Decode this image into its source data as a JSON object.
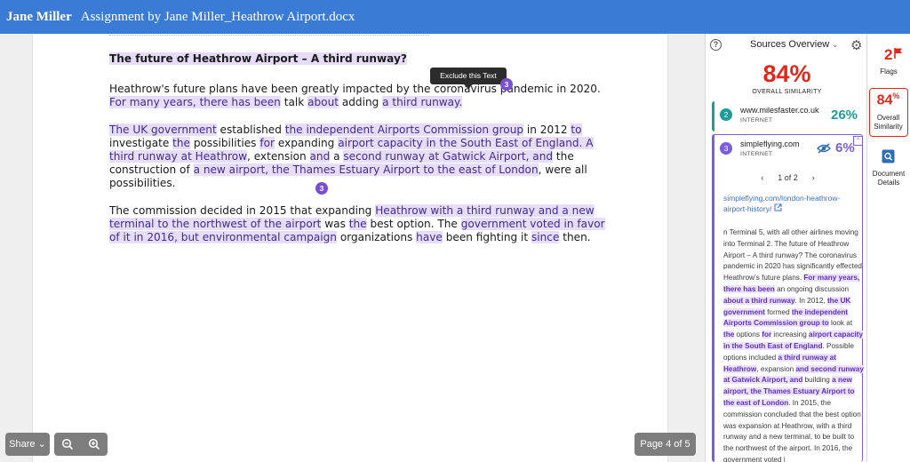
{
  "header": {
    "user": "Jane Miller",
    "doc_title": "Assignment by Jane Miller_Heathrow Airport.docx"
  },
  "document": {
    "title": "The future of Heathrow Airport – A third runway?",
    "tooltip": "Exclude this Text",
    "marker": "3",
    "p1": {
      "a": "Heathrow's future plans have been greatly impacted by the coronavirus pandemic in 2020. ",
      "b": "For many years, there has been",
      "c": " talk ",
      "d": "about",
      "e": " adding ",
      "f": "a third runway."
    },
    "p2": {
      "a": "The UK government",
      "b": " established ",
      "c": "the independent Airports Commission group",
      "d": " in 2012 ",
      "e": "to",
      "f": " investigate ",
      "g": "the",
      "h": " possibilities ",
      "i": "for",
      "j": " expanding ",
      "k": "airport capacity in the South East of England. A third runway at Heathrow",
      "l": ", extension ",
      "m": "and",
      "n": " a ",
      "o": "second runway at Gatwick Airport, and",
      "p": " the construction of ",
      "q": "a new airport, the Thames Estuary Airport to the east of London",
      "r": ", were all possibilities."
    },
    "p3": {
      "a": "The commission decided in 2015 that expanding ",
      "b": "Heathrow with a third runway and a new terminal to the northwest of the airport",
      "c": " was ",
      "d": "the",
      "e": " best option. The ",
      "f": "government voted in favor of it in 2016, but environmental campaign",
      "g": " organizations ",
      "h": "have",
      "i": " been fighting it ",
      "j": "since",
      "k": " then."
    }
  },
  "controls": {
    "share": "Share ⌄",
    "page_counter": "Page 4 of 5"
  },
  "panel": {
    "title": "Sources Overview",
    "overall_pct": "84%",
    "overall_label": "OVERALL SIMILARITY",
    "sources": [
      {
        "num": "2",
        "url": "www.milesfaster.co.uk",
        "type": "INTERNET",
        "pct": "26%",
        "color": "#1e9c98"
      },
      {
        "num": "3",
        "url": "simpleflying.com",
        "type": "INTERNET",
        "pct": "6%",
        "color": "#7c5de0"
      }
    ],
    "pager": "1 of 2",
    "link": "simpleflying.com/london-heathrow-airport-history/",
    "text": [
      {
        "t": "n Terminal 5, with all other airlines moving into Terminal 2. The future of Heathrow Airport – A third runway? The coronavirus pandemic in 2020 has significantly effected Heathrow’s future plans. "
      },
      {
        "t": "For many years, there has been",
        "m": true
      },
      {
        "t": " an ongoing discussion "
      },
      {
        "t": "about a third runway",
        "m": true
      },
      {
        "t": ". In 2012, "
      },
      {
        "t": "the UK government",
        "m": true
      },
      {
        "t": " formed "
      },
      {
        "t": "the independent Airports Commission group to",
        "m": true
      },
      {
        "t": " look at "
      },
      {
        "t": "the",
        "m": true
      },
      {
        "t": " options "
      },
      {
        "t": "for",
        "m": true
      },
      {
        "t": " increasing "
      },
      {
        "t": "airport capacity in the South East of England",
        "m": true
      },
      {
        "t": ". Possible options included "
      },
      {
        "t": "a third runway at Heathrow",
        "m": true
      },
      {
        "t": ", expansion "
      },
      {
        "t": "and second runway at Gatwick Airport, and",
        "m": true
      },
      {
        "t": " building "
      },
      {
        "t": "a new airport, the Thames Estuary Airport to the east of London",
        "m": true
      },
      {
        "t": ". In 2015, the commission concluded that the best option was expansion at Heathrow, with a third runway and a new terminal, to be built to the northwest of the airport. In 2016, the government voted i"
      }
    ]
  },
  "rail": {
    "flags_count": "2",
    "flags_label": "Flags",
    "sim_pct": "84",
    "sim_pct_sign": "%",
    "sim_label_1": "Overall",
    "sim_label_2": "Similarity",
    "doc_label_1": "Document",
    "doc_label_2": "Details"
  },
  "colors": {
    "header": "#3a7bd5",
    "accent_red": "#e0281b",
    "highlight": "#e8ddf9",
    "purple": "#7c5de0",
    "teal": "#1e9c98"
  }
}
